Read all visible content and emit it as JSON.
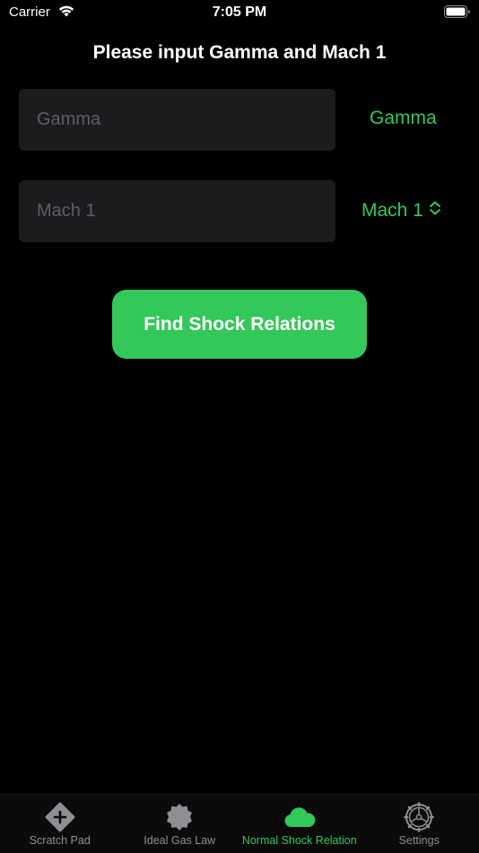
{
  "status_bar": {
    "carrier": "Carrier",
    "time": "7:05 PM"
  },
  "header": {
    "title": "Please input Gamma and Mach 1"
  },
  "form": {
    "gamma": {
      "value": "",
      "placeholder": "Gamma",
      "side_label": "Gamma"
    },
    "mach": {
      "value": "",
      "placeholder": "Mach 1",
      "selector_label": "Mach 1",
      "selector_icon": "chevron-up-down-icon"
    },
    "submit_label": "Find Shock Relations"
  },
  "tabs": [
    {
      "label": "Scratch Pad",
      "icon": "plus-diamond-icon",
      "active": false
    },
    {
      "label": "Ideal Gas Law",
      "icon": "seal-badge-icon",
      "active": false
    },
    {
      "label": "Normal Shock Relation",
      "icon": "cloud-icon",
      "active": true
    },
    {
      "label": "Settings",
      "icon": "gear-icon",
      "active": false
    }
  ],
  "colors": {
    "background": "#000000",
    "accent": "#34c759",
    "field_background": "#1c1c1e",
    "placeholder": "#5e5e62",
    "inactive_tab": "#8e8e93"
  }
}
